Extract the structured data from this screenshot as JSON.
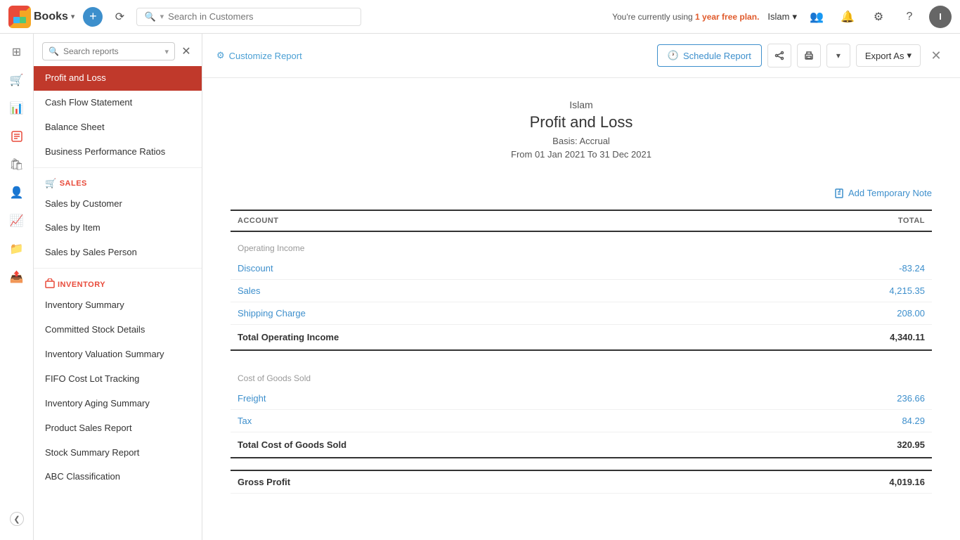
{
  "topnav": {
    "logo_initials": "Z",
    "logo_label": "Books",
    "logo_dropdown_icon": "▾",
    "add_icon": "+",
    "history_icon": "⟳",
    "search_placeholder": "Search in Customers",
    "search_filter_icon": "▾",
    "free_plan_text": "You're currently using ",
    "free_plan_bold": "1 year free plan.",
    "user_name": "Islam",
    "user_dropdown": "▾",
    "user_initial": "I",
    "icons": [
      "👥",
      "🔔",
      "⚙",
      "?"
    ]
  },
  "sidebar": {
    "icons": [
      "⊞",
      "🛒",
      "📊",
      "🏛",
      "🛍",
      "👤",
      "📈",
      "📁",
      "📤"
    ],
    "toggle_label": "❮"
  },
  "reports_panel": {
    "search_placeholder": "Search reports",
    "search_icon": "🔍",
    "close_icon": "✕",
    "dropdown_icon": "▾",
    "active_item": "Profit and Loss",
    "items_top": [
      {
        "label": "Profit and Loss",
        "active": true
      },
      {
        "label": "Cash Flow Statement"
      },
      {
        "label": "Balance Sheet"
      },
      {
        "label": "Business Performance Ratios"
      }
    ],
    "section_sales": {
      "label": "SALES",
      "icon": "🛒",
      "items": [
        {
          "label": "Sales by Customer"
        },
        {
          "label": "Sales by Item"
        },
        {
          "label": "Sales by Sales Person"
        }
      ]
    },
    "section_inventory": {
      "label": "INVENTORY",
      "icon": "📦",
      "items": [
        {
          "label": "Inventory Summary"
        },
        {
          "label": "Committed Stock Details"
        },
        {
          "label": "Inventory Valuation Summary"
        },
        {
          "label": "FIFO Cost Lot Tracking"
        },
        {
          "label": "Inventory Aging Summary"
        },
        {
          "label": "Product Sales Report"
        },
        {
          "label": "Stock Summary Report"
        },
        {
          "label": "ABC Classification"
        }
      ]
    }
  },
  "toolbar": {
    "customize_label": "Customize Report",
    "customize_icon": "⚙",
    "schedule_label": "Schedule Report",
    "schedule_icon": "🕐",
    "share_icon": "⬆",
    "print_icon": "🖨",
    "more_icon": "▾",
    "export_label": "Export As",
    "export_icon": "▾",
    "close_icon": "✕"
  },
  "report": {
    "company": "Islam",
    "title": "Profit and Loss",
    "basis_label": "Basis: Accrual",
    "date_range": "From 01 Jan 2021 To 31 Dec 2021",
    "add_note_label": "Add Temporary Note",
    "add_note_icon": "📋",
    "table": {
      "col_account": "ACCOUNT",
      "col_total": "TOTAL",
      "sections": [
        {
          "section_label": "Operating Income",
          "rows": [
            {
              "account": "Discount",
              "total": "-83.24",
              "is_link": true
            },
            {
              "account": "Sales",
              "total": "4,215.35",
              "is_link": true
            },
            {
              "account": "Shipping Charge",
              "total": "208.00",
              "is_link": true
            }
          ],
          "total_label": "Total Operating Income",
          "total_value": "4,340.11"
        },
        {
          "section_label": "Cost of Goods Sold",
          "rows": [
            {
              "account": "Freight",
              "total": "236.66",
              "is_link": true
            },
            {
              "account": "Tax",
              "total": "84.29",
              "is_link": true
            }
          ],
          "total_label": "Total Cost of Goods Sold",
          "total_value": "320.95"
        },
        {
          "section_label": "",
          "rows": [],
          "total_label": "Gross Profit",
          "total_value": "4,019.16",
          "is_grand": true
        }
      ]
    }
  }
}
